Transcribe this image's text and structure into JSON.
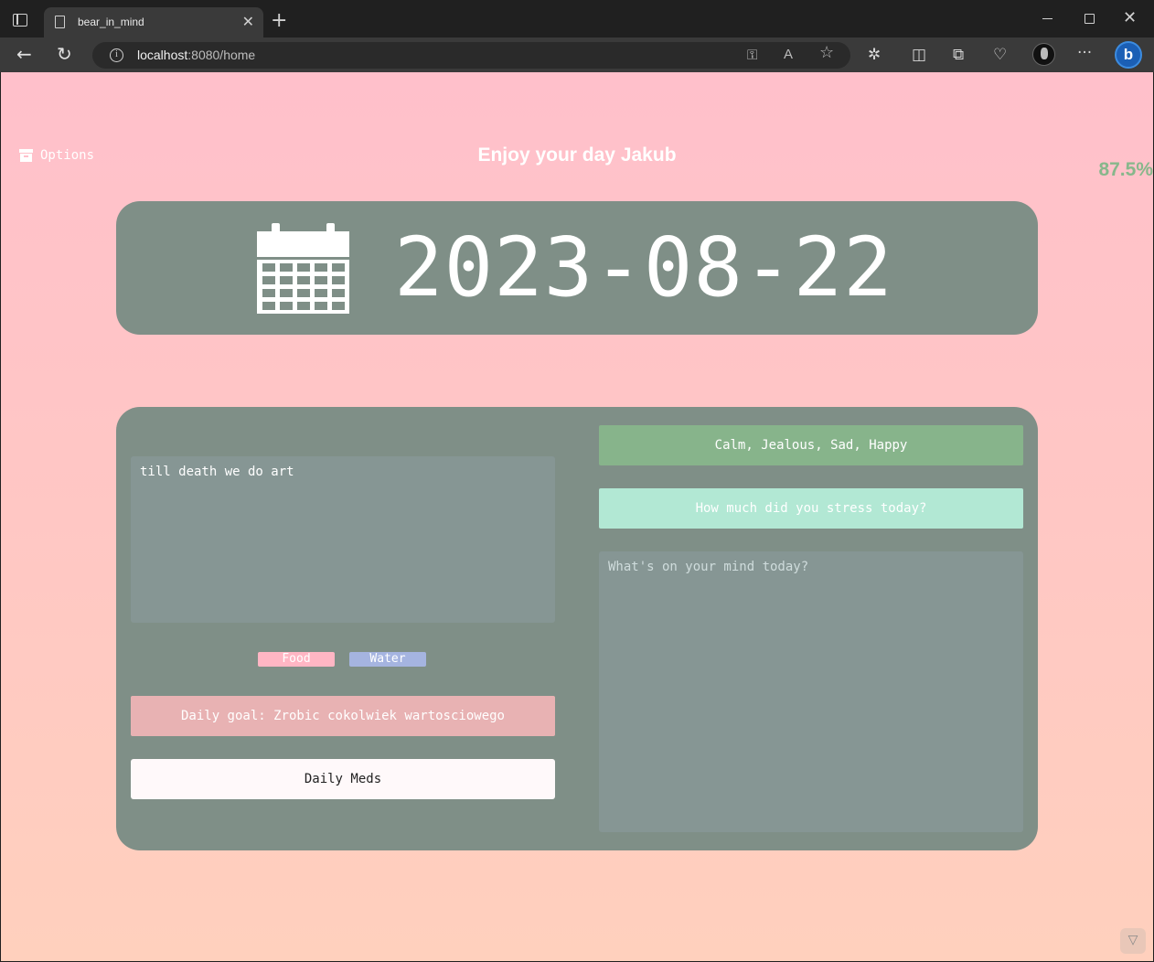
{
  "browser": {
    "tab_title": "bear_in_mind",
    "url_host": "localhost",
    "url_path": ":8080/home",
    "icons": {
      "tab_actions": "tab-actions-icon",
      "page": "page-icon",
      "close_tab": "✕",
      "new_tab": "+",
      "back": "←",
      "reload": "↻",
      "site_info": "i",
      "key": "⚿",
      "read_aloud": "A",
      "favorite": "☆",
      "extensions": "✲",
      "split_screen": "◫",
      "collections": "⧉",
      "health": "♡",
      "more": "···",
      "bing": "b",
      "window_close": "✕"
    }
  },
  "page": {
    "options_label": "Options",
    "greeting": "Enjoy your day Jakub",
    "percent": "87.5%",
    "date": "2023-08-22",
    "quote": "till death we do art",
    "tags": {
      "food": "Food",
      "water": "Water"
    },
    "daily_goal": "Daily goal: Zrobic cokolwiek wartosciowego",
    "daily_meds": "Daily Meds",
    "moods": "Calm, Jealous, Sad, Happy",
    "stress_prompt": "How much did you stress today?",
    "journal_placeholder": "What's on your mind today?"
  },
  "colors": {
    "bg_top": "#ffc0cb",
    "bg_bottom": "#ffd0bd",
    "card": "#7f8f87",
    "text_area": "#869694",
    "percent": "#87b78b",
    "food_tag": "#ffb6c4",
    "water_tag": "#a5b4e0",
    "goal": "#e8b2b3",
    "meds": "#fff9fa",
    "moods": "#87b48b",
    "stress": "#b2e8d4"
  }
}
